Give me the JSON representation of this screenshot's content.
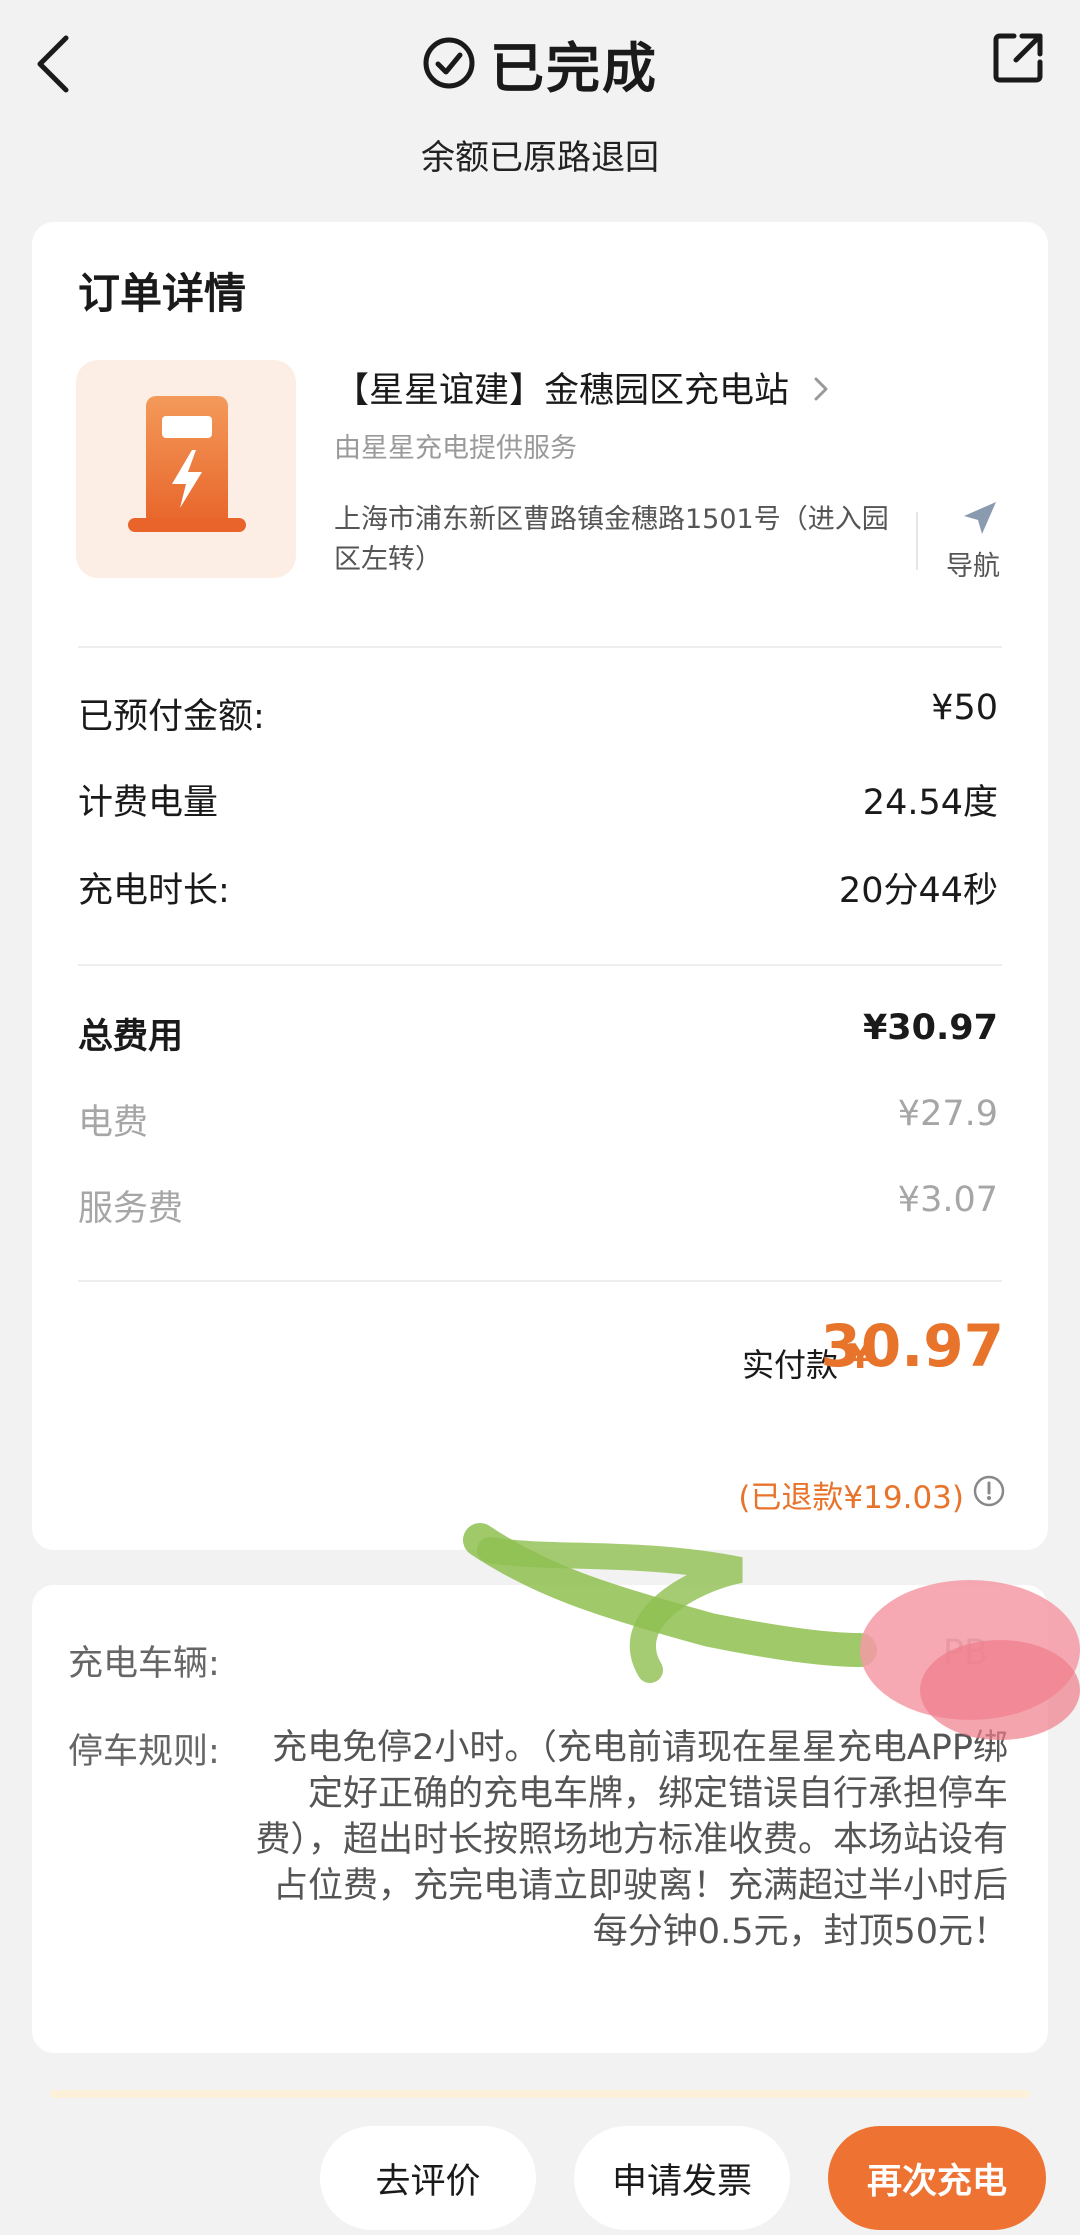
{
  "header": {
    "title": "已完成",
    "subtitle": "余额已原路退回",
    "back_icon": "chevron-left-icon",
    "status_icon": "check-circle-icon",
    "share_icon": "share-external-icon"
  },
  "order": {
    "section_title": "订单详情",
    "station": {
      "name": "【星星谊建】金穗园区充电站",
      "provider": "由星星充电提供服务",
      "address": "上海市浦东新区曹路镇金穗路1501号（进入园区左转）",
      "nav_label": "导航",
      "icon": "charging-station-icon",
      "accent_color": "#ee7232"
    },
    "details": [
      {
        "label": "已预付金额:",
        "value": "¥50"
      },
      {
        "label": "计费电量",
        "value": "24.54度"
      },
      {
        "label": "充电时长:",
        "value": "20分44秒"
      }
    ],
    "fees": {
      "total_label": "总费用",
      "total_value": "¥30.97",
      "electricity_label": "电费",
      "electricity_value": "¥27.9",
      "service_label": "服务费",
      "service_value": "¥3.07"
    },
    "payment": {
      "paid_label": "实付款",
      "currency": "¥",
      "paid_amount": "30.97",
      "refund_note": "(已退款¥19.03)"
    }
  },
  "vehicle": {
    "vehicle_label": "充电车辆:",
    "plate": "PB",
    "parking_label": "停车规则:",
    "parking_rules": "充电免停2小时。（充电前请现在星星充电APP绑定好正确的充电车牌，绑定错误自行承担停车费），超出时长按照场地方标准收费。本场站设有占位费，充完电请立即驶离！充满超过半小时后每分钟0.5元，封顶50元！"
  },
  "actions": {
    "review": "去评价",
    "invoice": "申请发票",
    "recharge": "再次充电"
  }
}
